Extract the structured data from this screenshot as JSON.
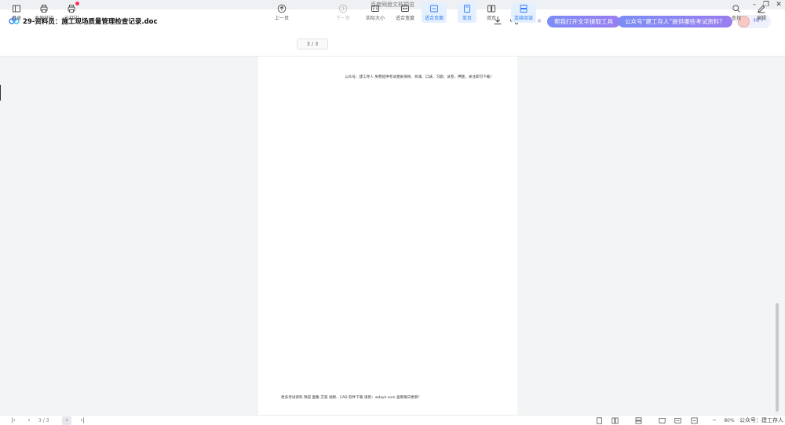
{
  "window": {
    "app_title": "百度网盘文档预览",
    "controls": {
      "minimize": "–",
      "restore": "❐",
      "close": "✕"
    }
  },
  "header": {
    "doc_title": "29-资料员：施工现场质量管理检查记录.doc",
    "icons": [
      "download-icon",
      "share-icon"
    ]
  },
  "promo": {
    "close": "×",
    "pill1": "帮我打开文字提取工具",
    "pill2": "公众号“建工存人”提供哪些考试资料？",
    "hi": "Hi ›"
  },
  "toolbar": {
    "left": [
      {
        "label": "目录",
        "icon": "outline-icon"
      },
      {
        "label": "本地打印",
        "icon": "printer-icon"
      },
      {
        "label": "云打印",
        "icon": "cloud-printer-icon"
      }
    ],
    "prev": "上一页",
    "page_indicator": "3 / 3",
    "next": "下一页",
    "view": [
      {
        "label": "实际大小",
        "icon": "actual-size-icon",
        "active": false
      },
      {
        "label": "适合宽度",
        "icon": "fit-width-icon",
        "active": false
      },
      {
        "label": "适合页面",
        "icon": "fit-page-icon",
        "active": true
      },
      {
        "label": "单页",
        "icon": "single-page-icon",
        "active": true
      },
      {
        "label": "双页",
        "icon": "double-page-icon",
        "active": false
      },
      {
        "label": "连续阅读",
        "icon": "continuous-icon",
        "active": true
      }
    ],
    "search": "查找",
    "edit": "编辑"
  },
  "page": {
    "header_text": "公众号：建工存人  免费提供考试相关资格、背诵、口诀、习题、试卷、押题，关注即可下载！",
    "footer_text": "更多考试资料 预览 图集 方案 视频、CAD 软件下载 请到：wdzyk.com 查看每日更新！"
  },
  "statusbar": {
    "first": "|‹",
    "prev": "‹",
    "pager": "3 / 3",
    "next": "›",
    "last": "›|",
    "zoom_minus": "−",
    "zoom_value": "80%",
    "watermark": "公众号：建工存人"
  },
  "colors": {
    "accent": "#2f7cf6",
    "pill_gradient_start": "#7b8cf6",
    "pill_gradient_end": "#9a7ef0",
    "badge_red": "#f5365c"
  }
}
